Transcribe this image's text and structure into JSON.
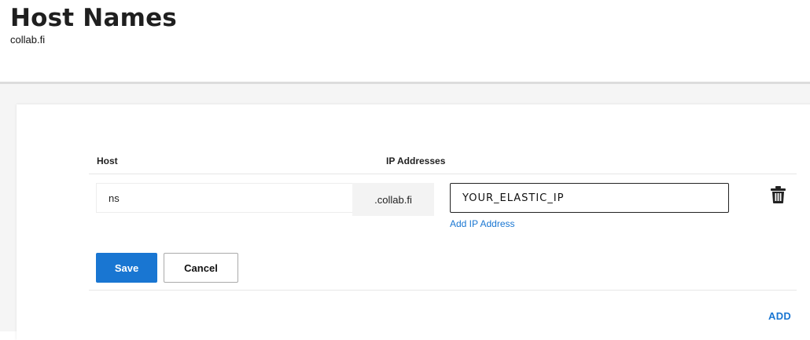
{
  "header": {
    "title": "Host Names",
    "domain": "collab.fi"
  },
  "table": {
    "columns": {
      "host": "Host",
      "ip": "IP Addresses"
    },
    "row": {
      "host_value": "ns",
      "domain_suffix": ".collab.fi",
      "ip_value": "YOUR_ELASTIC_IP",
      "add_ip_label": "Add IP Address",
      "delete_icon": "trash-icon"
    }
  },
  "actions": {
    "save_label": "Save",
    "cancel_label": "Cancel",
    "add_label": "ADD"
  },
  "colors": {
    "accent": "#1976d2",
    "page_bg": "#f5f5f5",
    "card_bg": "#ffffff"
  }
}
